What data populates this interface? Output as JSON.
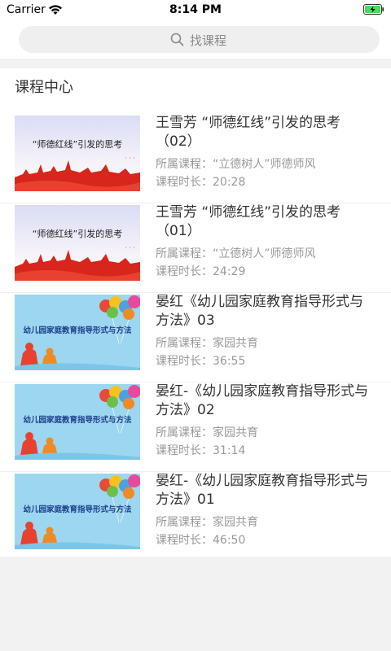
{
  "status_bar": {
    "carrier": "Carrier",
    "time": "8:14 PM"
  },
  "search": {
    "placeholder": "找课程"
  },
  "section_title": "课程中心",
  "labels": {
    "course_prefix": "所属课程：",
    "duration_prefix": "课程时长："
  },
  "courses": [
    {
      "title": "王雪芳 “师德红线”引发的思考（02）",
      "course": "“立德树人”师德师风",
      "duration": "20:28",
      "thumbnail": "red-banner",
      "thumbnail_text": "“师德红线”引发的思考"
    },
    {
      "title": "王雪芳 “师德红线”引发的思考（01）",
      "course": "“立德树人”师德师风",
      "duration": "24:29",
      "thumbnail": "red-banner",
      "thumbnail_text": "“师德红线”引发的思考"
    },
    {
      "title": "晏红《幼儿园家庭教育指导形式与方法》03",
      "course": "家园共育",
      "duration": "36:55",
      "thumbnail": "balloon-banner",
      "thumbnail_text": "幼儿园家庭教育指导形式与方法"
    },
    {
      "title": "晏红-《幼儿园家庭教育指导形式与方法》02",
      "course": "家园共育",
      "duration": "31:14",
      "thumbnail": "balloon-banner",
      "thumbnail_text": "幼儿园家庭教育指导形式与方法"
    },
    {
      "title": "晏红-《幼儿园家庭教育指导形式与方法》01",
      "course": "家园共育",
      "duration": "46:50",
      "thumbnail": "balloon-banner",
      "thumbnail_text": "幼儿园家庭教育指导形式与方法"
    }
  ],
  "colors": {
    "background": "#f2f2f2",
    "panel": "#ffffff",
    "search_box": "#efefef",
    "battery": "#4cd964",
    "banner_red": "#d8261c",
    "banner_sky": "#9cd6f0"
  },
  "icons": {
    "wifi": "wifi-icon",
    "battery": "battery-charging-icon",
    "search": "search-icon"
  }
}
